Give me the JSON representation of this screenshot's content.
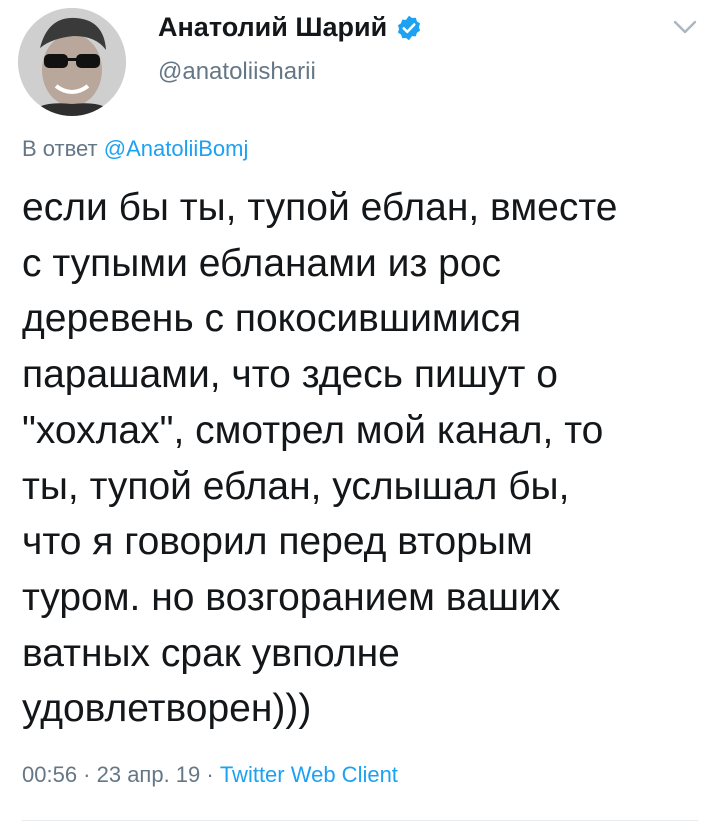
{
  "colors": {
    "text": "#14171a",
    "secondary": "#657786",
    "link": "#1da1f2",
    "verified": "#1da1f2"
  },
  "author": {
    "display_name": "Анатолий Шарий",
    "handle": "@anatoliishariі",
    "verified_icon": "verified-badge-icon",
    "menu_icon": "chevron-down-icon"
  },
  "reply": {
    "prefix": "В ответ ",
    "to_handle": "@AnatoliiBomj"
  },
  "tweet": {
    "text": "если бы ты, тупой еблан, вместе\nс тупыми ебланами из рос\nдеревень с покосившимися\nпарашами, что здесь пишут о\n\"хохлах\", смотрел мой канал, то\nты, тупой еблан, услышал бы,\nчто я говорил перед вторым\nтуром. но возгоранием ваших\nватных срак увполне\nудовлетворен)))"
  },
  "meta": {
    "timestamp": "00:56 · 23 апр. 19 · ",
    "client": "Twitter Web Client"
  }
}
